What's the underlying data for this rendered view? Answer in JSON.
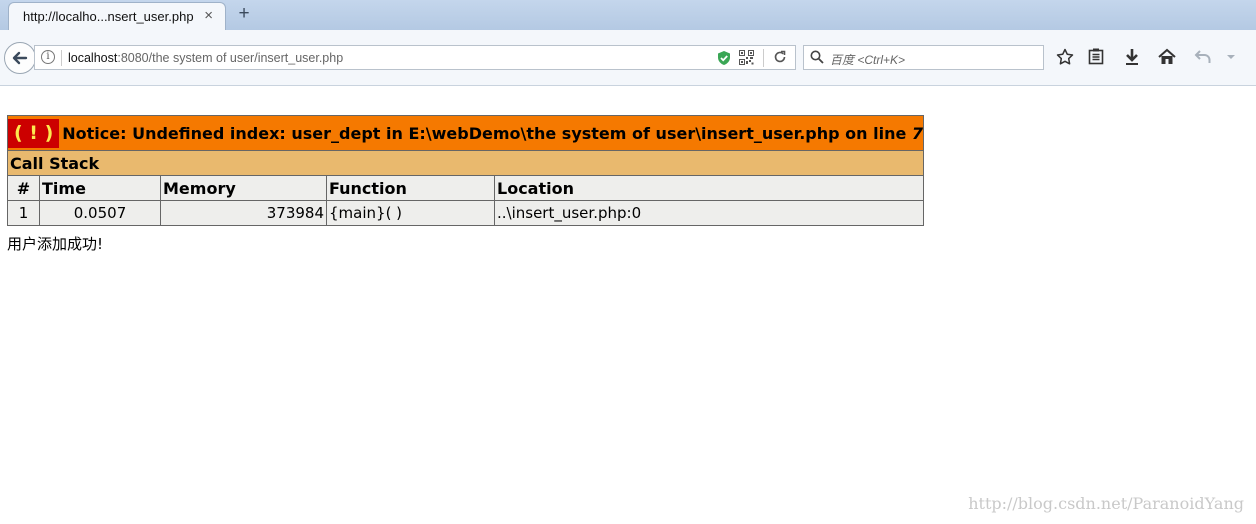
{
  "browser": {
    "tab": {
      "title": "http://localho...nsert_user.php",
      "close_glyph": "×"
    },
    "new_tab_glyph": "+",
    "url": {
      "host": "localhost",
      "rest": ":8080/the system of user/insert_user.php"
    },
    "search": {
      "placeholder": "百度 <Ctrl+K>"
    },
    "icons": [
      "back-arrow-icon",
      "info-icon",
      "shield-icon",
      "qr-code-icon",
      "reload-icon",
      "search-icon",
      "star-icon",
      "reading-list-icon",
      "download-icon",
      "home-icon",
      "undo-icon",
      "dropdown-icon"
    ]
  },
  "page": {
    "notice": {
      "bang": "( ! )",
      "message": "Notice: Undefined index: user_dept in E:\\webDemo\\the system of user\\insert_user.php on line ",
      "line": "7"
    },
    "call_stack": {
      "title": "Call Stack",
      "headers": {
        "num": "#",
        "time": "Time",
        "memory": "Memory",
        "function": "Function",
        "location": "Location"
      },
      "rows": [
        {
          "num": "1",
          "time": "0.0507",
          "memory": "373984",
          "function": "{main}( )",
          "location": "..\\insert_user.php:0"
        }
      ]
    },
    "success_message": "用户添加成功!"
  },
  "watermark": "http://blog.csdn.net/ParanoidYang",
  "colors": {
    "notice_bg": "#f57900",
    "bang_bg": "#cc0000",
    "bang_fg": "#fce94f",
    "callstack_bg": "#e9b96e",
    "cell_bg": "#eeeeec"
  }
}
